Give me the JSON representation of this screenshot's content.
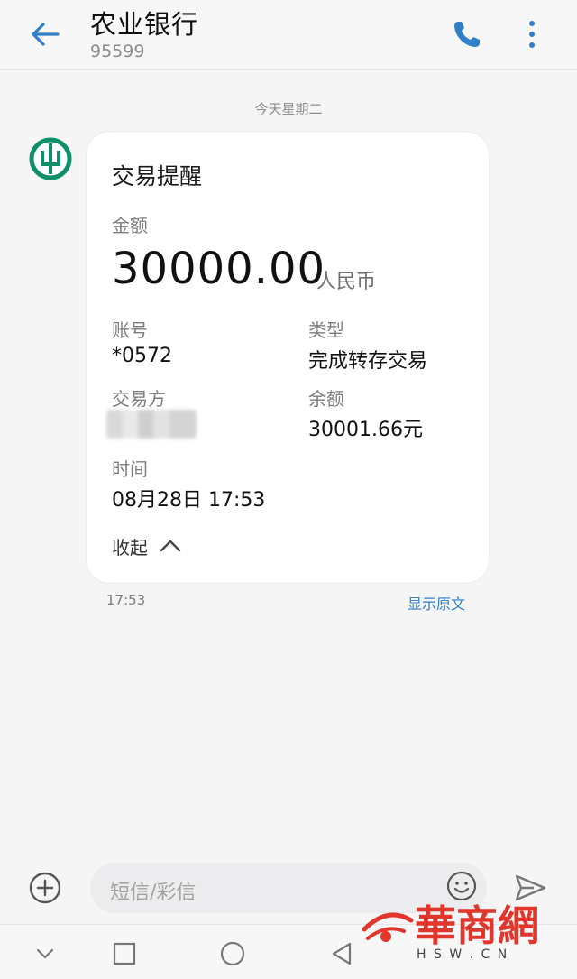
{
  "header": {
    "title": "农业银行",
    "number": "95599"
  },
  "date_separator": "今天星期二",
  "message": {
    "title": "交易提醒",
    "amount_label": "金额",
    "amount": "30000.00",
    "currency": "人民币",
    "account_label": "账号",
    "account": "*0572",
    "type_label": "类型",
    "type": "完成转存交易",
    "counterparty_label": "交易方",
    "balance_label": "余额",
    "balance": "30001.66元",
    "time_label": "时间",
    "time": "08月28日 17:53",
    "collapse_label": "收起",
    "sent_time": "17:53",
    "show_original": "显示原文"
  },
  "compose": {
    "placeholder": "短信/彩信"
  },
  "watermark": {
    "brand": "華商網",
    "domain": "H S W . C N"
  },
  "colors": {
    "accent": "#2f7fc9",
    "bank_green": "#0e8f6a",
    "watermark_red": "#e0362c"
  },
  "icons": [
    "back-arrow-icon",
    "phone-icon",
    "more-vertical-icon",
    "bank-logo-icon",
    "chevron-up-icon",
    "plus-circle-icon",
    "emoji-icon",
    "send-icon",
    "nav-back-icon",
    "nav-home-icon",
    "nav-recents-icon",
    "nav-down-icon"
  ]
}
